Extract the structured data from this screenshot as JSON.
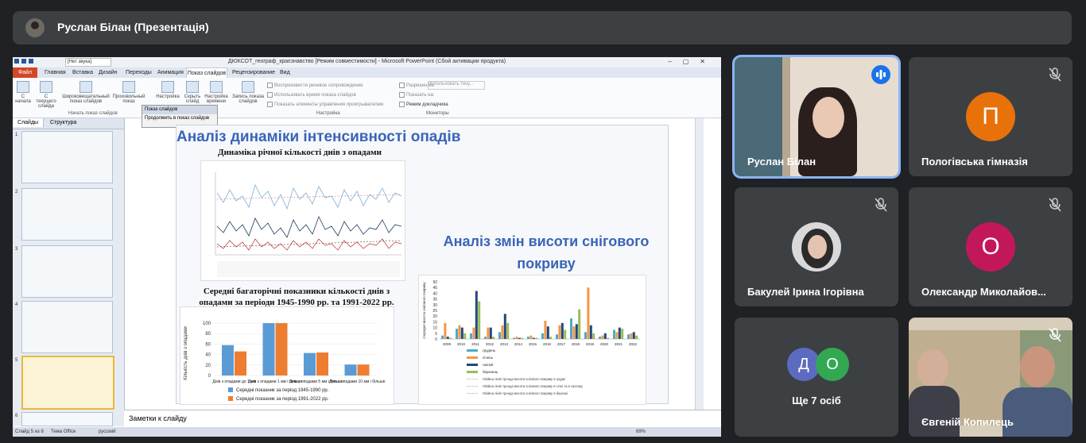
{
  "meet": {
    "presenter_title": "Руслан Білан (Презентація)"
  },
  "participants": [
    {
      "name": "Руслан Білан",
      "state": "speaking"
    },
    {
      "name": "Пологівська гімназія",
      "initial": "П",
      "color": "#e8710a",
      "state": "muted"
    },
    {
      "name": "Бакулей Ірина Ігорівна",
      "state": "muted"
    },
    {
      "name": "Олександр Миколайов...",
      "initial": "О",
      "color": "#c2185b",
      "state": "muted"
    },
    {
      "name": "Ще 7 осіб",
      "initials": [
        "Д",
        "О"
      ],
      "colors": [
        "#5c6bc0",
        "#33a852"
      ]
    },
    {
      "name": "Євгеній Копилець",
      "state": "muted"
    }
  ],
  "ppt": {
    "window_title": "ДЮКСОТ_географ_краєзнавство [Режим совместимости] - Microsoft PowerPoint (Сбой активации продукта)",
    "style_select": "[Нет звука]",
    "tabs": [
      "Файл",
      "Главная",
      "Вставка",
      "Дизайн",
      "Переходы",
      "Анимация",
      "Показ слайдов",
      "Рецензирование",
      "Вид"
    ],
    "active_tab": "Показ слайдов",
    "ribbon": {
      "buttons": [
        "С начала",
        "С текущего слайда",
        "Широковещательный показ слайдов",
        "Произвольный показ",
        "Настройка",
        "Скрыть слайд",
        "Настройка времени",
        "Запись показа слайдов"
      ],
      "checks": [
        "Воспроизвести речевое сопровождение",
        "Использовать время показа слайдов",
        "Показать элементы управления проигрывателем"
      ],
      "monitor_labels": [
        "Разрешение:",
        "Показать на:",
        "Режим докладчика"
      ],
      "monitor_value": "Использовать теку...",
      "groups": [
        "Начать показ слайдов",
        "Настройка",
        "Мониторы"
      ]
    },
    "flyout": {
      "title": "Показ слайдов",
      "item": "Продолжить в показ слайдов"
    },
    "panel_tabs": [
      "Слайды",
      "Структура"
    ],
    "slide_numbers": [
      "1",
      "2",
      "3",
      "4",
      "5",
      "6"
    ],
    "notes_label": "Заметки к слайду",
    "status": {
      "slide": "Слайд 5 из 8",
      "theme": "Тема Office",
      "lang": "русский",
      "zoom": "69%"
    }
  },
  "slide": {
    "title": "Аналіз динаміки інтенсивності опадів",
    "chart1_title": "Динаміка річної кількості днів з опадами",
    "chart2_title": "Середні багаторічні показники кількості днів з опадами за періоди 1945-1990 рр. та 1991-2022 рр.",
    "title2": "Аналіз змін висоти снігового покриву"
  },
  "chart_data": [
    {
      "type": "bar",
      "ylabel": "Кількість днів з опадами",
      "categories": [
        "Днів з опадами до 1 мм",
        "Днів з опадами 1 мм і більше",
        "Днів з опадами 5 мм і більше",
        "Днів з опадами 10 мм і більше"
      ],
      "ylim": [
        0,
        100
      ],
      "yticks": [
        "0",
        "20",
        "40",
        "60",
        "80",
        "100"
      ],
      "series": [
        {
          "name": "Середні показник за період 1945-1990 рр.",
          "color": "#5b9bd5",
          "values": [
            58,
            100,
            43,
            21
          ]
        },
        {
          "name": "Середні показник за період 1991-2022 рр.",
          "color": "#ed7d31",
          "values": [
            46,
            100,
            44,
            21
          ]
        }
      ]
    },
    {
      "type": "bar",
      "ylabel": "Середня висота снігового покриву",
      "categories": [
        "2009",
        "2010",
        "2011",
        "2012",
        "2013",
        "2014",
        "2015",
        "2016",
        "2017",
        "2018",
        "2019",
        "2020",
        "2021",
        "2022"
      ],
      "ylim": [
        0,
        50
      ],
      "yticks": [
        "0",
        "5",
        "10",
        "15",
        "20",
        "25",
        "30",
        "35",
        "40",
        "45",
        "50"
      ],
      "series": [
        {
          "name": "грудень",
          "color": "#4bacc6",
          "values": [
            3,
            9,
            5,
            2,
            6,
            1,
            2,
            5,
            4,
            18,
            6,
            2,
            8,
            4
          ]
        },
        {
          "name": "січень",
          "color": "#f79646",
          "values": [
            14,
            12,
            10,
            10,
            12,
            2,
            3,
            16,
            12,
            11,
            45,
            3,
            6,
            5
          ]
        },
        {
          "name": "лютий",
          "color": "#1f497d",
          "values": [
            2,
            10,
            42,
            10,
            22,
            1,
            1,
            11,
            14,
            13,
            12,
            5,
            10,
            6
          ]
        },
        {
          "name": "березень",
          "color": "#9bbb59",
          "values": [
            1,
            5,
            33,
            2,
            14,
            1,
            1,
            2,
            8,
            26,
            5,
            1,
            9,
            3
          ]
        }
      ],
      "trend_labels": [
        "Лінійна лінія тренда висоти снігового покриву в грудні",
        "Лінійна лінія тренда висоти снігового покриву в січні та в лютому",
        "Лінійна лінія тренда висоти снігового покриву в березні"
      ]
    }
  ]
}
